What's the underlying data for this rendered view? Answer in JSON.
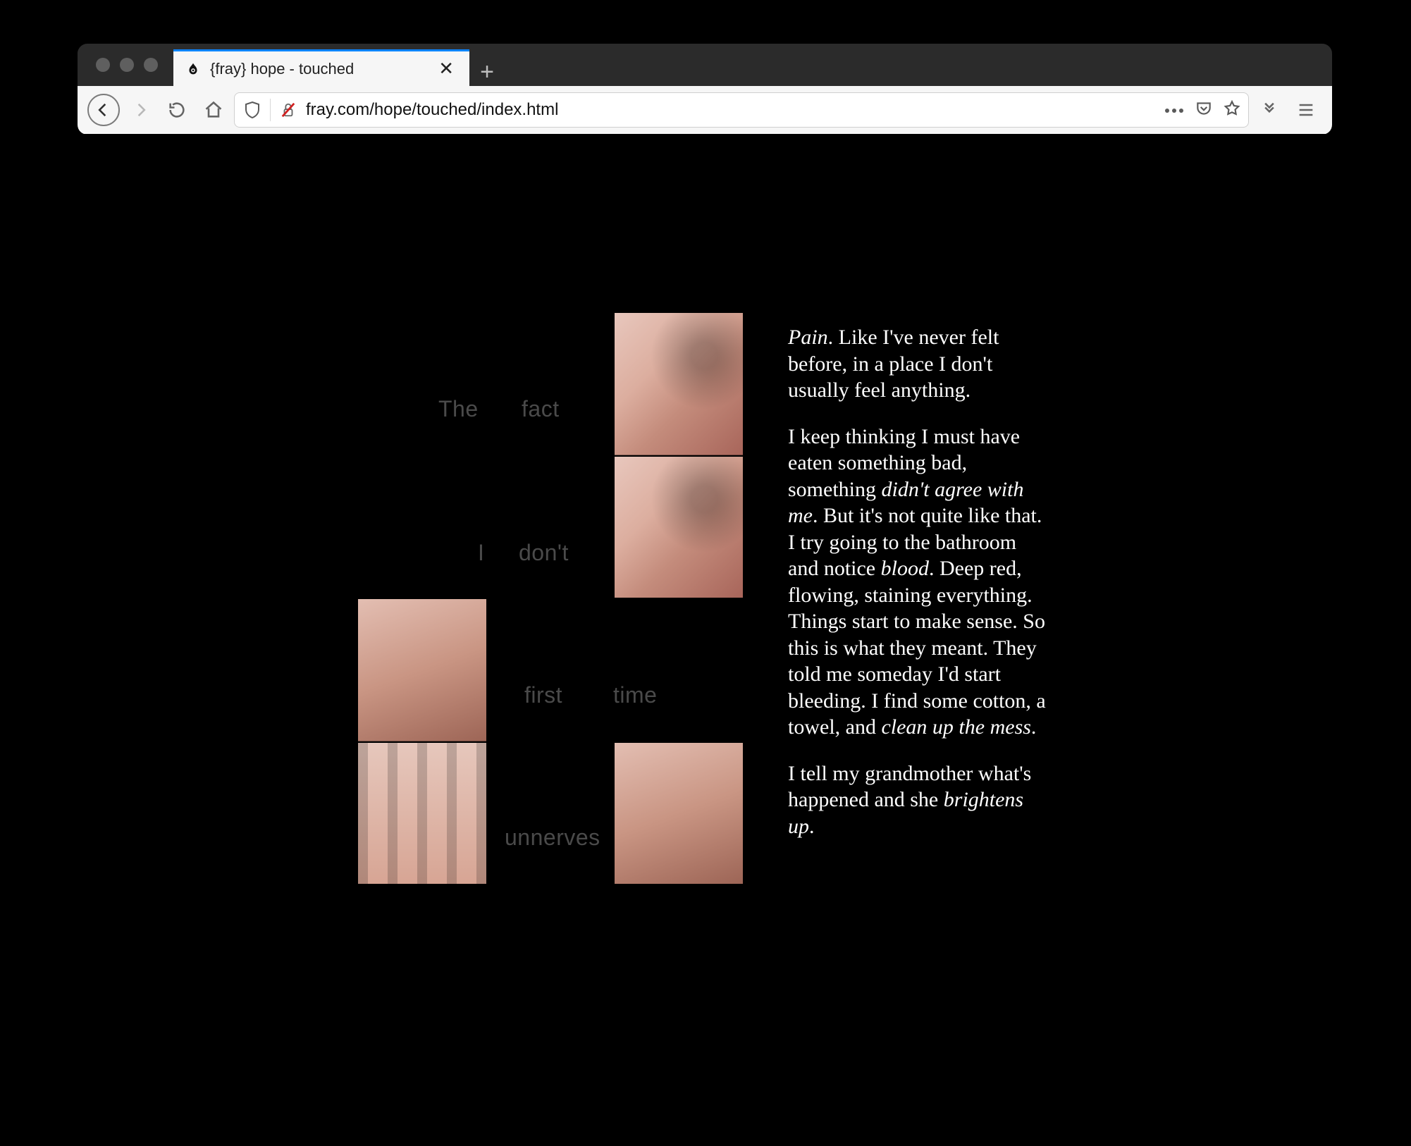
{
  "browser": {
    "tab": {
      "title": "{fray} hope - touched",
      "close_glyph": "✕",
      "newtab_glyph": "+"
    },
    "url": "fray.com/hope/touched/index.html"
  },
  "poem": {
    "w1": "The",
    "w2": "fact",
    "w3": "I",
    "w4": "don't",
    "w5": "first",
    "w6": "time",
    "w7": "unnerves"
  },
  "story": {
    "p1_em": "Pain",
    "p1_rest": ". Like I've never felt before, in a place I don't usually feel anything.",
    "p2_a": "I keep thinking I must have eaten something bad, something ",
    "p2_em1": "didn't agree with me",
    "p2_b": ". But it's not quite like that. I try going to the bathroom and notice ",
    "p2_em2": "blood",
    "p2_c": ". Deep red, flowing, staining everything. Things start to make sense. So this is what they meant. They told me someday I'd start bleeding. I find some cotton, a towel, and ",
    "p2_em3": "clean up the mess",
    "p2_d": ".",
    "p3_a": "I tell my grandmother what's happened and she ",
    "p3_em": "brightens up",
    "p3_b": "."
  }
}
